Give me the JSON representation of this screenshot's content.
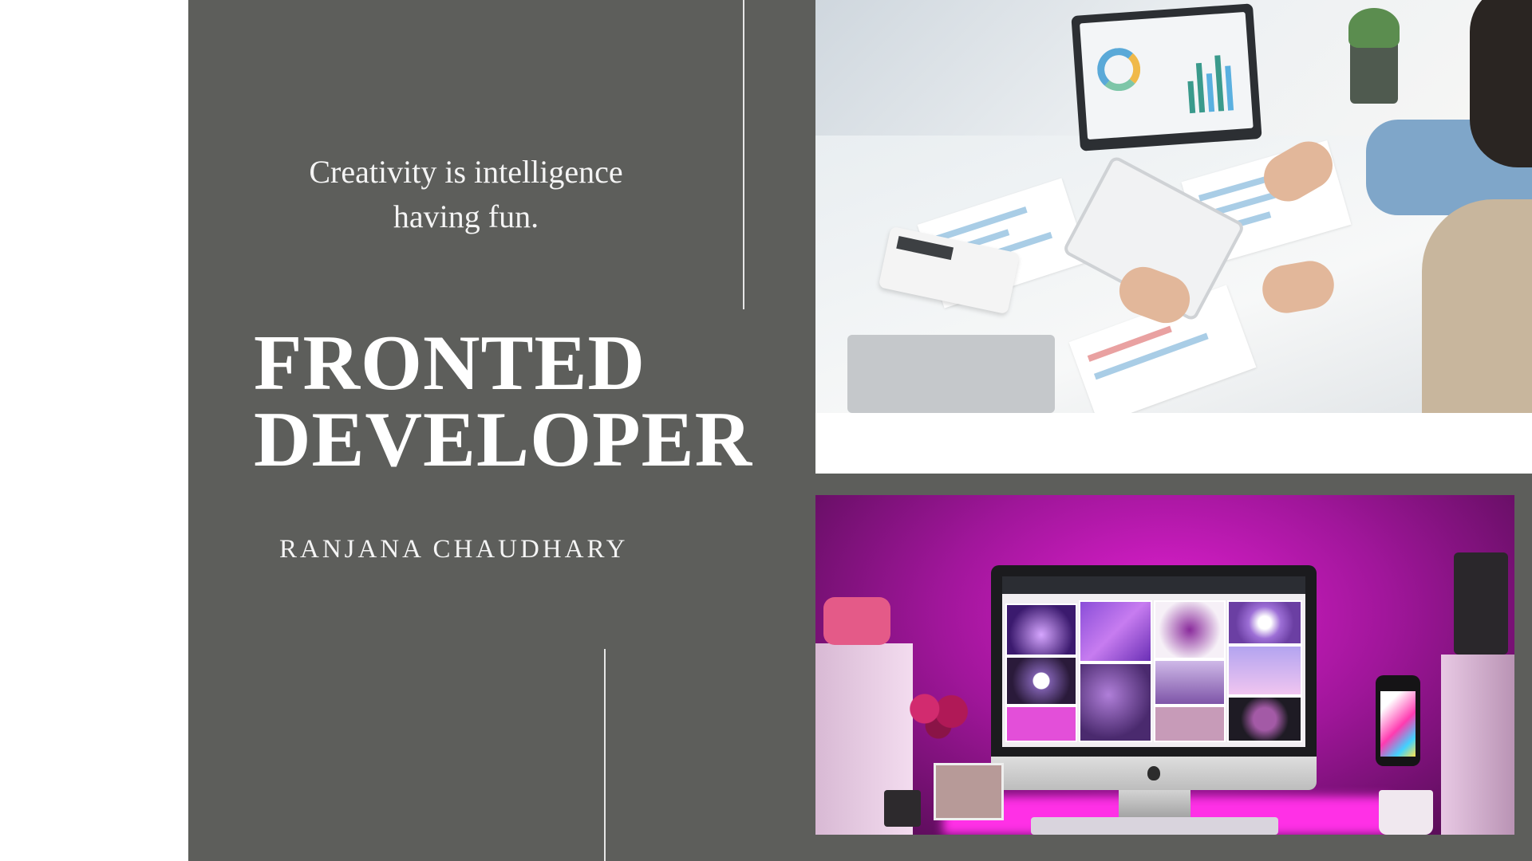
{
  "slide": {
    "quote_line1": "Creativity is intelligence",
    "quote_line2": "having fun.",
    "title_line1": "FRONTED",
    "title_line2": "DEVELOPER",
    "author": "RANJANA CHAUDHARY"
  },
  "colors": {
    "panel": "#5d5e5b",
    "text": "#ffffff",
    "accent_pink": "#e01fd0"
  },
  "images": {
    "top": "office-desk-photo",
    "bottom": "pink-desk-setup-photo"
  }
}
